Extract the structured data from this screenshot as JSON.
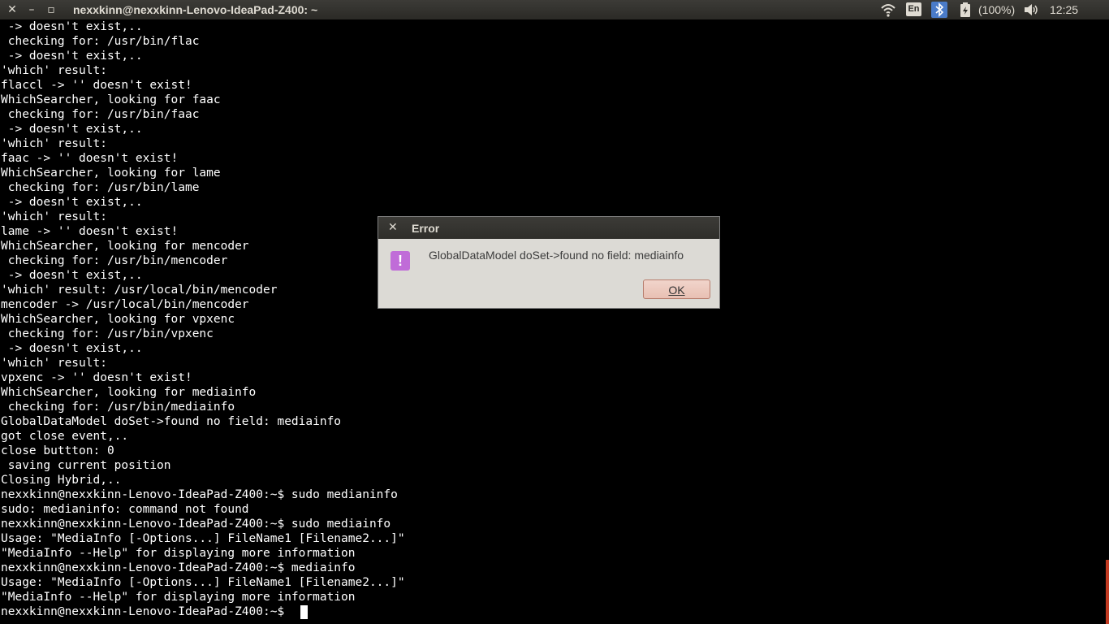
{
  "window": {
    "title": "nexxkinn@nexxkinn-Lenovo-IdeaPad-Z400: ~",
    "close_glyph": "✕",
    "minimize_glyph": "–",
    "restore_glyph": "▫"
  },
  "indicators": {
    "wifi_icon": "wifi-icon",
    "language": "En",
    "bluetooth_icon": "bluetooth-icon",
    "battery_icon": "battery-icon",
    "battery_text": "(100%)",
    "volume_icon": "volume-icon",
    "time": "12:25"
  },
  "terminal": {
    "lines": [
      " -> doesn't exist,..",
      " checking for: /usr/bin/flac",
      " -> doesn't exist,..",
      "'which' result:",
      "flaccl -> '' doesn't exist!",
      "WhichSearcher, looking for faac",
      " checking for: /usr/bin/faac",
      " -> doesn't exist,..",
      "'which' result:",
      "faac -> '' doesn't exist!",
      "WhichSearcher, looking for lame",
      " checking for: /usr/bin/lame",
      " -> doesn't exist,..",
      "'which' result:",
      "lame -> '' doesn't exist!",
      "WhichSearcher, looking for mencoder",
      " checking for: /usr/bin/mencoder",
      " -> doesn't exist,..",
      "'which' result: /usr/local/bin/mencoder",
      "mencoder -> /usr/local/bin/mencoder",
      "WhichSearcher, looking for vpxenc",
      " checking for: /usr/bin/vpxenc",
      " -> doesn't exist,..",
      "'which' result:",
      "vpxenc -> '' doesn't exist!",
      "WhichSearcher, looking for mediainfo",
      " checking for: /usr/bin/mediainfo",
      "GlobalDataModel doSet->found no field: mediainfo",
      "got close event,..",
      "close buttton: 0",
      " saving current position",
      "Closing Hybrid,..",
      "nexxkinn@nexxkinn-Lenovo-IdeaPad-Z400:~$ sudo medianinfo",
      "sudo: medianinfo: command not found",
      "nexxkinn@nexxkinn-Lenovo-IdeaPad-Z400:~$ sudo mediainfo",
      "Usage: \"MediaInfo [-Options...] FileName1 [Filename2...]\"",
      "\"MediaInfo --Help\" for displaying more information",
      "nexxkinn@nexxkinn-Lenovo-IdeaPad-Z400:~$ mediainfo",
      "Usage: \"MediaInfo [-Options...] FileName1 [Filename2...]\"",
      "\"MediaInfo --Help\" for displaying more information",
      "nexxkinn@nexxkinn-Lenovo-IdeaPad-Z400:~$ "
    ]
  },
  "dialog": {
    "title": "Error",
    "close_glyph": "✕",
    "warning_glyph": "!",
    "message": "GlobalDataModel doSet->found no field: mediainfo",
    "ok_label": "OK"
  }
}
